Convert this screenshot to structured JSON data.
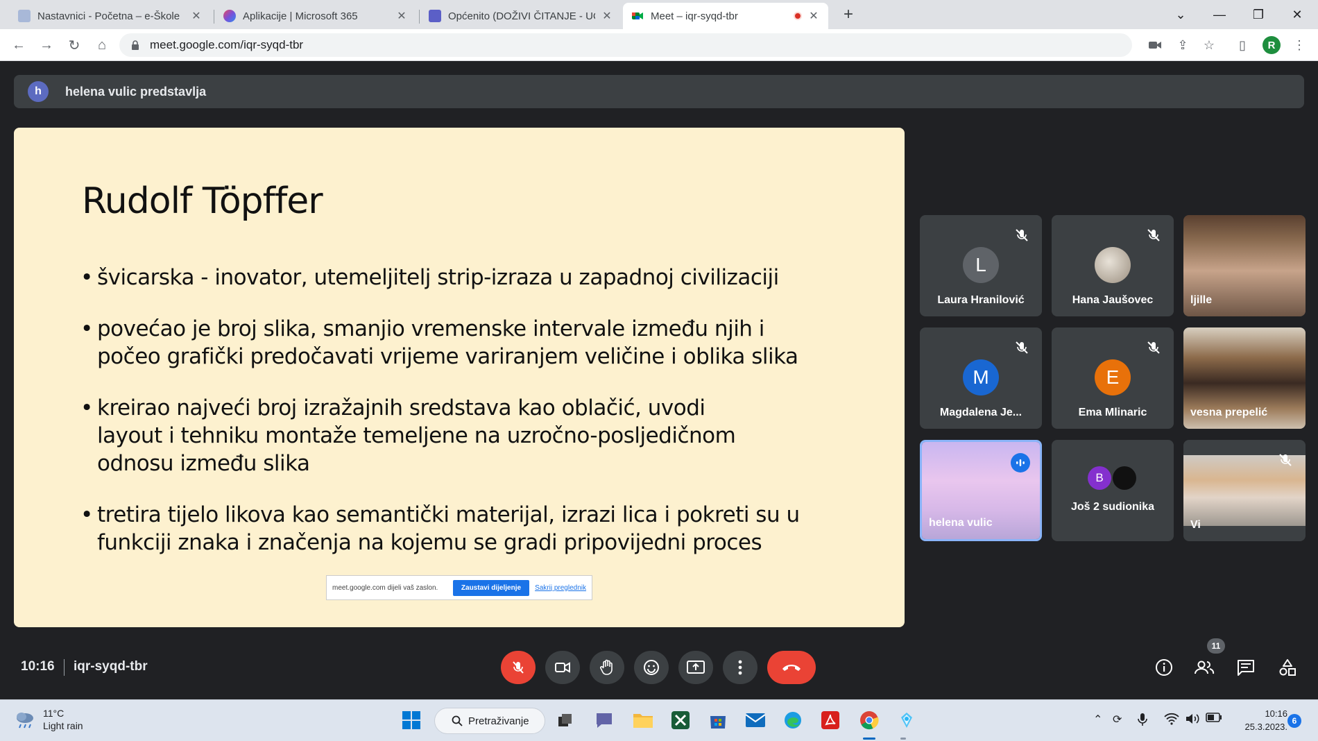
{
  "browser": {
    "tabs": [
      {
        "title": "Nastavnici - Početna – e-Škole",
        "active": false
      },
      {
        "title": "Aplikacije | Microsoft 365",
        "active": false
      },
      {
        "title": "Općenito (DOŽIVI ČITANJE - UČE",
        "active": false
      },
      {
        "title": "Meet – iqr-syqd-tbr",
        "active": true
      }
    ],
    "url": "meet.google.com/iqr-syqd-tbr",
    "profile_initial": "R"
  },
  "meet": {
    "presenter_initial": "h",
    "presenter_text": "helena vulic predstavlja",
    "slide": {
      "title": "Rudolf Töpffer",
      "bullets": [
        "švicarska - inovator, utemeljitelj strip-izraza u zapadnoj civilizaciji",
        "povećao je broj slika, smanjio vremenske intervale između njih i počeo grafički predočavati vrijeme variranjem veličine i oblika slika",
        "kreirao najveći broj izražajnih sredstava kao oblačić, uvodi layout i tehniku montaže temeljene na uzročno-posljedičnom odnosu između slika",
        "tretira tijelo likova kao semantički materijal, izrazi lica i pokreti su u funkciji znaka i značenja na kojemu se gradi pripovijedni proces"
      ],
      "share_bar": {
        "message": "meet.google.com dijeli vaš zaslon.",
        "stop_label": "Zaustavi dijeljenje",
        "hide_label": "Sakrij preglednik"
      }
    },
    "participants": [
      {
        "name": "Laura Hranilović",
        "initial": "L",
        "color": "#5f6368",
        "muted": true
      },
      {
        "name": "Hana Jaušovec",
        "initial": "",
        "color": "#b0a89a",
        "muted": true
      },
      {
        "name": "ljille",
        "initial": "",
        "muted": false
      },
      {
        "name": "Magdalena Je...",
        "initial": "M",
        "color": "#1967d2",
        "muted": true
      },
      {
        "name": "Ema Mlinaric",
        "initial": "E",
        "color": "#e8710a",
        "muted": true
      },
      {
        "name": "vesna prepelić",
        "initial": "",
        "muted": false
      },
      {
        "name": "helena vulic",
        "initial": "",
        "speaking": true
      },
      {
        "name": "Još 2 sudionika",
        "initials": [
          "B",
          ""
        ]
      },
      {
        "name": "Vi",
        "initial": "",
        "muted": true
      }
    ],
    "time": "10:16",
    "meeting_code": "iqr-syqd-tbr",
    "participant_count": "11"
  },
  "taskbar": {
    "weather_temp": "11°C",
    "weather_desc": "Light rain",
    "search_label": "Pretraživanje",
    "time": "10:16",
    "date": "25.3.2023.",
    "notification_count": "6"
  }
}
